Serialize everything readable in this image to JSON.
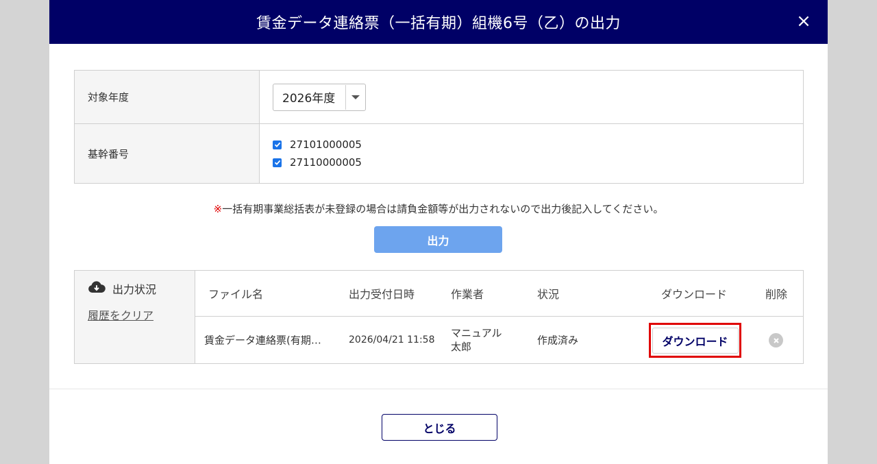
{
  "modal": {
    "title": "賃金データ連絡票（一括有期）組機6号（乙）の出力",
    "close_symbol": "×"
  },
  "form": {
    "year_label": "対象年度",
    "year_value": "2026年度",
    "code_label": "基幹番号",
    "codes": [
      "27101000005",
      "27110000005"
    ]
  },
  "notice": {
    "mark": "※",
    "text": "一括有期事業総括表が未登録の場合は請負金額等が出力されないので出力後記入してください。"
  },
  "output_button": "出力",
  "status": {
    "title": "出力状況",
    "clear_link": "履歴をクリア",
    "columns": {
      "file": "ファイル名",
      "date": "出力受付日時",
      "worker": "作業者",
      "state": "状況",
      "download": "ダウンロード",
      "delete": "削除"
    },
    "rows": [
      {
        "file": "賃金データ連絡票(有期…",
        "date": "2026/04/21 11:58",
        "worker_line1": "マニュアル",
        "worker_line2": "太郎",
        "state": "作成済み",
        "download_label": "ダウンロード"
      }
    ]
  },
  "close_button": "とじる",
  "colors": {
    "header_bg": "#000066",
    "primary_button": "#6da4ee",
    "highlight_border": "#e00000",
    "checkbox": "#1a73e8"
  },
  "icons": [
    "close-icon",
    "dropdown-arrow-icon",
    "checkbox-checked-icon",
    "cloud-download-icon",
    "delete-circle-icon"
  ]
}
